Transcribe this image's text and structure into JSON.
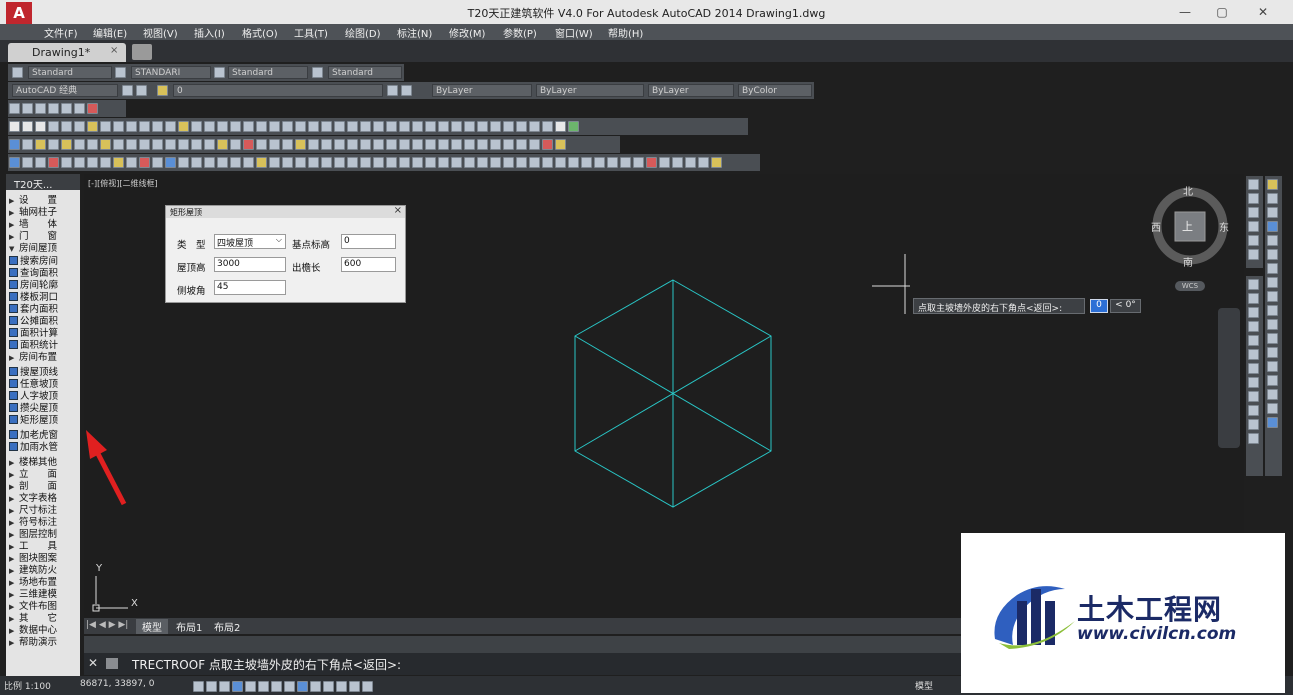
{
  "window": {
    "title": "T20天正建筑软件 V4.0 For Autodesk AutoCAD 2014    Drawing1.dwg",
    "logo_letter": "A",
    "minimize": "—",
    "maximize": "▢",
    "close": "✕"
  },
  "menu": [
    "文件(F)",
    "编辑(E)",
    "视图(V)",
    "插入(I)",
    "格式(O)",
    "工具(T)",
    "绘图(D)",
    "标注(N)",
    "修改(M)",
    "参数(P)",
    "窗口(W)",
    "帮助(H)"
  ],
  "doc_tab": {
    "label": "Drawing1*",
    "close": "×"
  },
  "styles_toolbar": {
    "text_style": "Standard",
    "dim_style": "STANDARI",
    "table_style": "Standard",
    "multileader_style": "Standard"
  },
  "workspace_toolbar": {
    "workspace": "AutoCAD 经典",
    "layer": "0",
    "color": "ByLayer",
    "linetype": "ByLayer",
    "lineweight": "ByLayer",
    "plotstyle": "ByColor"
  },
  "t20_panel": {
    "title": "T20天...",
    "items": [
      {
        "label": "设　　置",
        "kind": "arrow"
      },
      {
        "label": "轴网柱子",
        "kind": "arrow"
      },
      {
        "label": "墙　　体",
        "kind": "arrow"
      },
      {
        "label": "门　　窗",
        "kind": "arrow"
      },
      {
        "label": "房间屋顶",
        "kind": "open"
      },
      {
        "label": "搜索房间",
        "kind": "icon"
      },
      {
        "label": "查询面积",
        "kind": "icon"
      },
      {
        "label": "房间轮廓",
        "kind": "icon"
      },
      {
        "label": "楼板洞口",
        "kind": "icon"
      },
      {
        "label": "套内面积",
        "kind": "icon"
      },
      {
        "label": "公摊面积",
        "kind": "icon"
      },
      {
        "label": "面积计算",
        "kind": "icon"
      },
      {
        "label": "面积统计",
        "kind": "icon"
      },
      {
        "label": "房间布置",
        "kind": "arrow"
      },
      {
        "label": "搜屋顶线",
        "kind": "icon"
      },
      {
        "label": "任意坡顶",
        "kind": "icon"
      },
      {
        "label": "人字坡顶",
        "kind": "icon"
      },
      {
        "label": "攒尖屋顶",
        "kind": "icon"
      },
      {
        "label": "矩形屋顶",
        "kind": "icon"
      },
      {
        "label": "加老虎窗",
        "kind": "icon"
      },
      {
        "label": "加雨水管",
        "kind": "icon"
      },
      {
        "label": "楼梯其他",
        "kind": "arrow"
      },
      {
        "label": "立　　面",
        "kind": "arrow"
      },
      {
        "label": "剖　　面",
        "kind": "arrow"
      },
      {
        "label": "文字表格",
        "kind": "arrow"
      },
      {
        "label": "尺寸标注",
        "kind": "arrow"
      },
      {
        "label": "符号标注",
        "kind": "arrow"
      },
      {
        "label": "图层控制",
        "kind": "arrow"
      },
      {
        "label": "工　　具",
        "kind": "arrow"
      },
      {
        "label": "图块图案",
        "kind": "arrow"
      },
      {
        "label": "建筑防火",
        "kind": "arrow"
      },
      {
        "label": "场地布置",
        "kind": "arrow"
      },
      {
        "label": "三维建模",
        "kind": "arrow"
      },
      {
        "label": "文件布图",
        "kind": "arrow"
      },
      {
        "label": "其　　它",
        "kind": "arrow"
      },
      {
        "label": "数据中心",
        "kind": "arrow"
      },
      {
        "label": "帮助演示",
        "kind": "arrow"
      }
    ]
  },
  "viewport_label": "[-][俯视][二维线框]",
  "dialog": {
    "title": "矩形屋顶",
    "type_label": "类　型",
    "type_value": "四坡屋顶",
    "base_elev_label": "基点标高",
    "base_elev_value": "0",
    "roof_height_label": "屋顶高",
    "roof_height_value": "3000",
    "eave_label": "出檐长",
    "eave_value": "600",
    "slope_label": "侧坡角",
    "slope_value": "45"
  },
  "viewcube": {
    "north": "北",
    "south": "南",
    "east": "东",
    "west": "西",
    "face": "上",
    "wcs": "WCS"
  },
  "ucs": {
    "x": "X",
    "y": "Y"
  },
  "prompt_tip": {
    "text": "点取主坡墙外皮的右下角点<返回>:",
    "value": "0",
    "angle": "< 0°"
  },
  "layout_tabs": [
    "模型",
    "布局1",
    "布局2"
  ],
  "command": {
    "text": "TRECTROOF 点取主坡墙外皮的右下角点<返回>:"
  },
  "status": {
    "scale": "比例 1:100",
    "coords": "86871,  33897, 0",
    "model": "模型"
  },
  "watermark": {
    "name": "土木工程网",
    "url": "www.civilcn.com"
  },
  "colors": {
    "drawing_lines": "#29c6c6",
    "accent_red": "#e02020",
    "logo_blue": "#1b2a66"
  }
}
